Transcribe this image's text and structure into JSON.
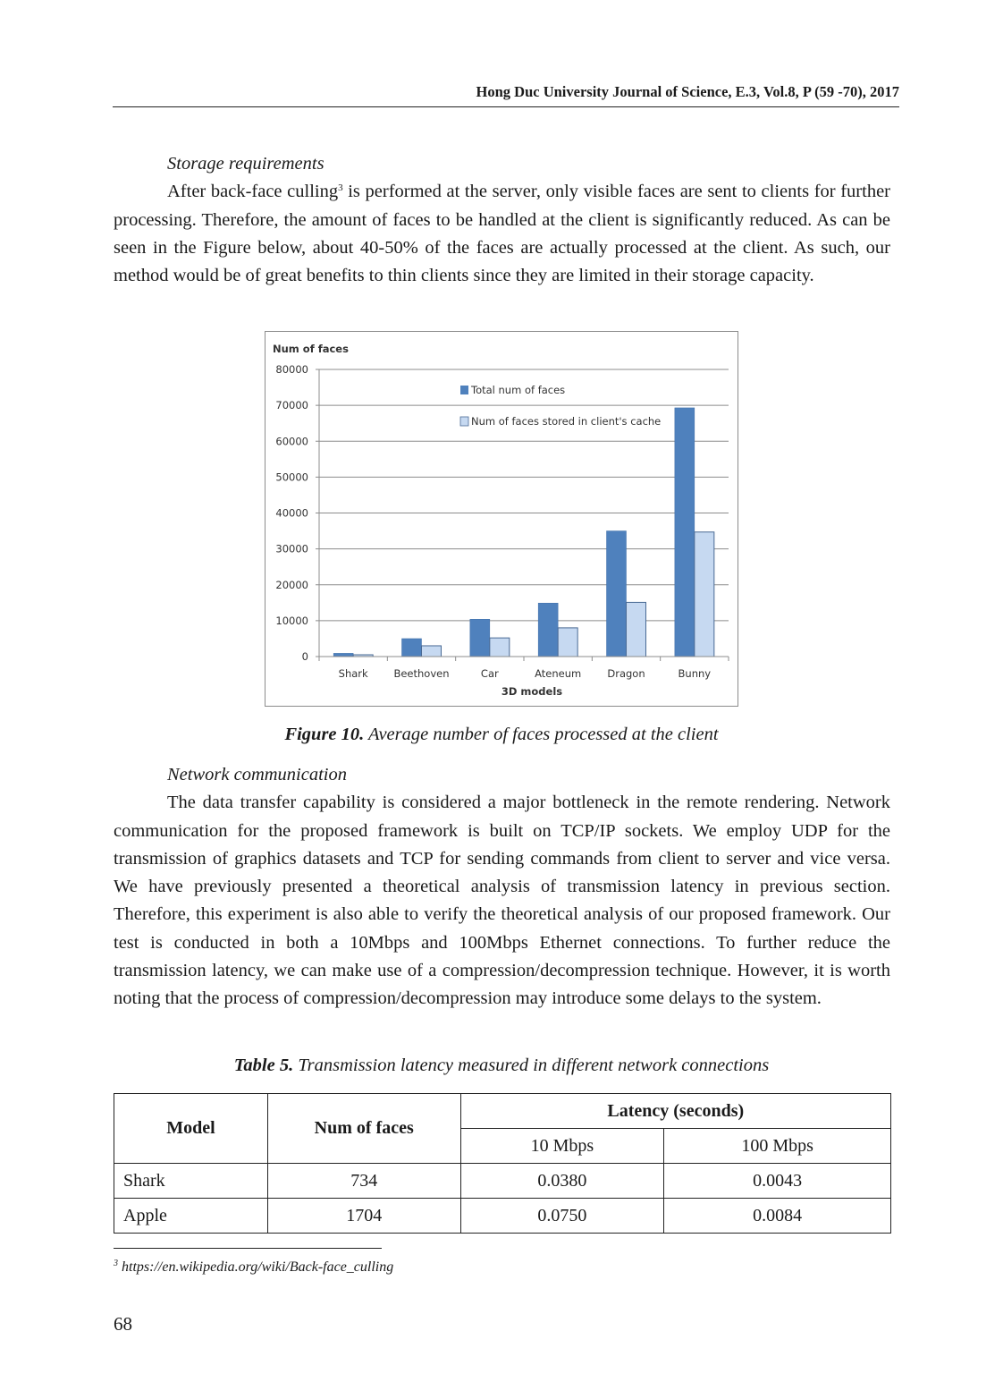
{
  "header": {
    "journal": "Hong Duc University Journal of Science, E.3, Vol.8, P (59 -70), 2017"
  },
  "section_storage": {
    "heading": "Storage requirements",
    "para_before_sup": "After back-face culling",
    "footnote_ref": "3",
    "para_after_sup": " is performed at the server, only visible faces are sent to clients for further processing. Therefore, the amount of faces to be handled at the client is significantly reduced. As can be seen in the Figure below, about 40-50% of the faces are actually processed at the client. As such, our method would be of great benefits to thin clients since they are limited in their storage capacity."
  },
  "figure": {
    "label": "Figure 10.",
    "caption": " Average number of faces processed at the client"
  },
  "chart_data": {
    "type": "bar",
    "title": "",
    "xlabel": "3D models",
    "ylabel": "Num of faces",
    "ylim": [
      0,
      80000
    ],
    "yticks": [
      "0",
      "10000",
      "20000",
      "30000",
      "40000",
      "50000",
      "60000",
      "70000",
      "80000"
    ],
    "grid": true,
    "legend_position": "top-center",
    "categories": [
      "Shark",
      "Beethoven",
      "Car",
      "Ateneum",
      "Dragon",
      "Bunny"
    ],
    "series": [
      {
        "name": "Total num of faces",
        "color": "#4f81bd",
        "values": [
          900,
          5000,
          10400,
          14900,
          35000,
          69300
        ]
      },
      {
        "name": "Num of faces stored in client's cache",
        "color": "#c6d9f1",
        "values": [
          500,
          3000,
          5200,
          8000,
          15100,
          34700
        ]
      }
    ]
  },
  "section_network": {
    "heading": "Network communication",
    "paragraph": "The data transfer capability is considered a major bottleneck in the remote rendering. Network communication for the proposed framework is built on TCP/IP sockets. We employ UDP for the transmission of graphics datasets and TCP for sending commands from client to server and vice versa. We have previously presented a theoretical analysis of transmission latency in previous section. Therefore, this experiment is also able to verify the theoretical analysis of our proposed framework. Our test is conducted in both a 10Mbps and 100Mbps Ethernet connections. To further reduce the transmission latency, we can make use of a compression/decompression technique. However, it is worth noting that the process of compression/decompression may introduce some delays to the system."
  },
  "table": {
    "label": "Table 5.",
    "caption": " Transmission latency measured in different network connections",
    "headers": {
      "model": "Model",
      "faces": "Num of faces",
      "latency": "Latency (seconds)",
      "mbps10": "10 Mbps",
      "mbps100": "100 Mbps"
    },
    "rows": [
      {
        "model": "Shark",
        "faces": "734",
        "l10": "0.0380",
        "l100": "0.0043"
      },
      {
        "model": "Apple",
        "faces": "1704",
        "l10": "0.0750",
        "l100": "0.0084"
      }
    ]
  },
  "footnote": {
    "number": "3",
    "text": " https://en.wikipedia.org/wiki/Back-face_culling"
  },
  "page_number": "68"
}
